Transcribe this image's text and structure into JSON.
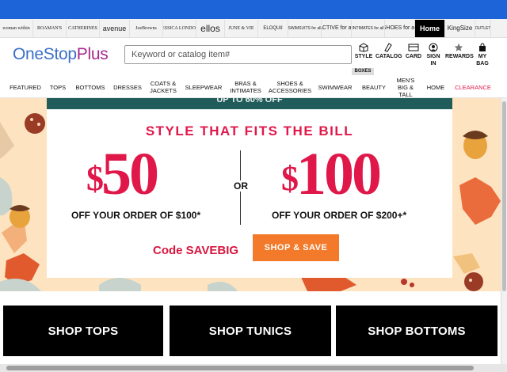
{
  "brands": [
    {
      "label": "woman within",
      "w": 42
    },
    {
      "label": "ROAMAN'S",
      "w": 42
    },
    {
      "label": "CATHERINES",
      "w": 42
    },
    {
      "label": "avenue",
      "w": 38
    },
    {
      "label": "JoeBrowns",
      "w": 42
    },
    {
      "label": "JESSICA LONDON",
      "w": 42
    },
    {
      "label": "ellos",
      "w": 36
    },
    {
      "label": "JUNE & VIE",
      "w": 42
    },
    {
      "label": "ELOQUII",
      "w": 38
    },
    {
      "label": "SWIMSUITS for all",
      "w": 42
    },
    {
      "label": "ACTIVE for all",
      "w": 38
    },
    {
      "label": "INTIMATES for all",
      "w": 42
    },
    {
      "label": "SHOES for all",
      "w": 38
    },
    {
      "label": "Home",
      "w": 38
    },
    {
      "label": "KingSize",
      "w": 38
    },
    {
      "label": "OUTLET",
      "w": 20
    }
  ],
  "header": {
    "logo_part1": "OneStop",
    "logo_part2": "Plus",
    "search_placeholder": "Keyword or catalog item#",
    "utilities": [
      {
        "label": "STYLE",
        "icon": "style-box-icon"
      },
      {
        "label": "CATALOG",
        "icon": "catalog-icon"
      },
      {
        "label": "CARD",
        "icon": "card-icon"
      },
      {
        "label": "SIGN IN",
        "icon": "user-icon"
      },
      {
        "label": "REWARDS",
        "icon": "star-icon"
      },
      {
        "label": "MY BAG",
        "icon": "bag-icon"
      }
    ],
    "boxes_label": "BOXES"
  },
  "nav": [
    {
      "label": "FEATURED"
    },
    {
      "label": "TOPS"
    },
    {
      "label": "BOTTOMS"
    },
    {
      "label": "DRESSES"
    },
    {
      "label": "COATS & JACKETS"
    },
    {
      "label": "SLEEPWEAR"
    },
    {
      "label": "BRAS & INTIMATES"
    },
    {
      "label": "SHOES & ACCESSORIES"
    },
    {
      "label": "SWIMWEAR"
    },
    {
      "label": "BEAUTY"
    },
    {
      "label": "MEN'S BIG & TALL"
    },
    {
      "label": "HOME"
    },
    {
      "label": "CLEARANCE"
    }
  ],
  "hero": {
    "teal_text": "UP TO 60% OFF",
    "headline": "STYLE THAT FITS THE BILL",
    "offer1_amount": "50",
    "offer1_text": "OFF YOUR ORDER OF $100*",
    "or_label": "OR",
    "offer2_amount": "100",
    "offer2_text": "OFF YOUR ORDER OF $200+*",
    "dollar": "$",
    "code": "Code SAVEBIG",
    "cta": "SHOP & SAVE",
    "colors": {
      "accent": "#e0184a",
      "cta": "#f27a2a",
      "teal": "#1f5c5a",
      "bg": "#fde3c0"
    }
  },
  "tiles": [
    {
      "label": "SHOP TOPS"
    },
    {
      "label": "SHOP TUNICS"
    },
    {
      "label": "SHOP BOTTOMS"
    }
  ]
}
